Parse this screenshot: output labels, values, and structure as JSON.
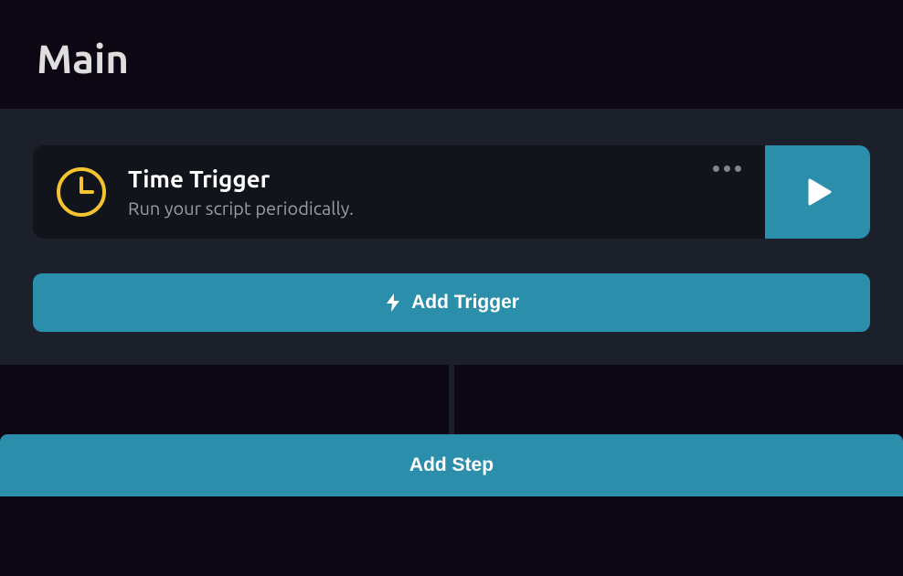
{
  "header": {
    "title": "Main"
  },
  "trigger": {
    "title": "Time Trigger",
    "subtitle": "Run your script periodically.",
    "icon": "clock-icon",
    "icon_color": "#f4c430"
  },
  "actions": {
    "add_trigger_label": "Add Trigger",
    "add_step_label": "Add Step",
    "more_label": "More options",
    "play_label": "Run"
  },
  "colors": {
    "accent": "#2b8eab",
    "panel": "#1b202b",
    "card": "#12141c",
    "bg": "#0d0713"
  }
}
